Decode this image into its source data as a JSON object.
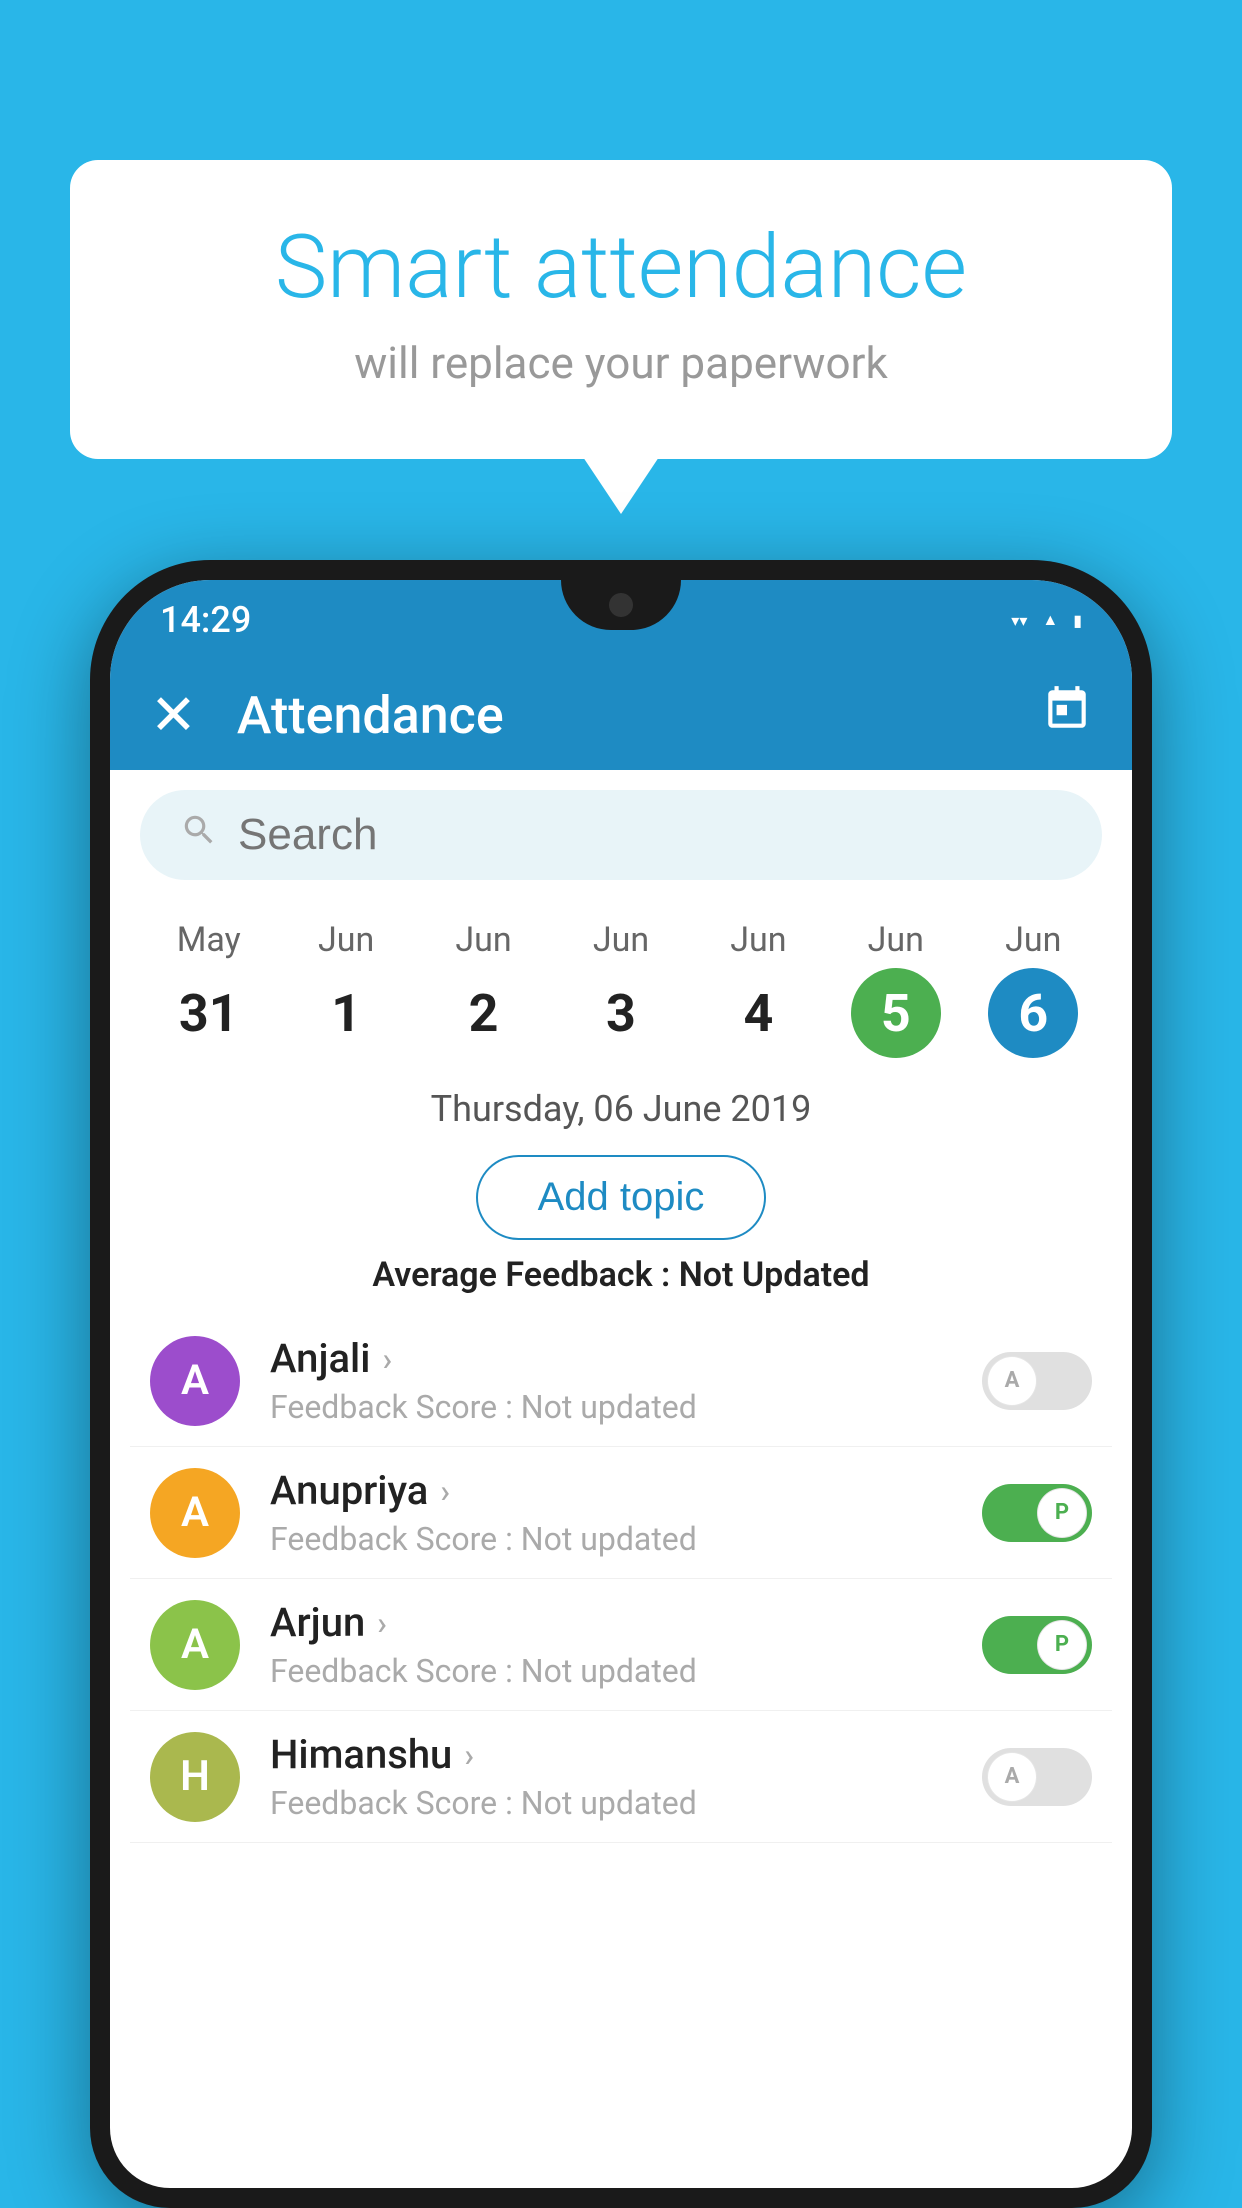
{
  "background_color": "#29b6e8",
  "bubble": {
    "title": "Smart attendance",
    "subtitle": "will replace your paperwork"
  },
  "status_bar": {
    "time": "14:29"
  },
  "app_bar": {
    "title": "Attendance",
    "close_label": "✕",
    "calendar_label": "📅"
  },
  "search": {
    "placeholder": "Search"
  },
  "dates": [
    {
      "month": "May",
      "day": "31",
      "state": "normal"
    },
    {
      "month": "Jun",
      "day": "1",
      "state": "normal"
    },
    {
      "month": "Jun",
      "day": "2",
      "state": "normal"
    },
    {
      "month": "Jun",
      "day": "3",
      "state": "normal"
    },
    {
      "month": "Jun",
      "day": "4",
      "state": "normal"
    },
    {
      "month": "Jun",
      "day": "5",
      "state": "today"
    },
    {
      "month": "Jun",
      "day": "6",
      "state": "selected"
    }
  ],
  "selected_date_label": "Thursday, 06 June 2019",
  "add_topic_label": "Add topic",
  "avg_feedback_label": "Average Feedback :",
  "avg_feedback_value": "Not Updated",
  "students": [
    {
      "name": "Anjali",
      "avatar_letter": "A",
      "avatar_color": "#9c4dcc",
      "feedback": "Feedback Score : Not updated",
      "attendance": "absent",
      "toggle_letter": "A"
    },
    {
      "name": "Anupriya",
      "avatar_letter": "A",
      "avatar_color": "#f5a623",
      "feedback": "Feedback Score : Not updated",
      "attendance": "present",
      "toggle_letter": "P"
    },
    {
      "name": "Arjun",
      "avatar_letter": "A",
      "avatar_color": "#8bc34a",
      "feedback": "Feedback Score : Not updated",
      "attendance": "present",
      "toggle_letter": "P"
    },
    {
      "name": "Himanshu",
      "avatar_letter": "H",
      "avatar_color": "#aab84e",
      "feedback": "Feedback Score : Not updated",
      "attendance": "absent",
      "toggle_letter": "A"
    }
  ]
}
